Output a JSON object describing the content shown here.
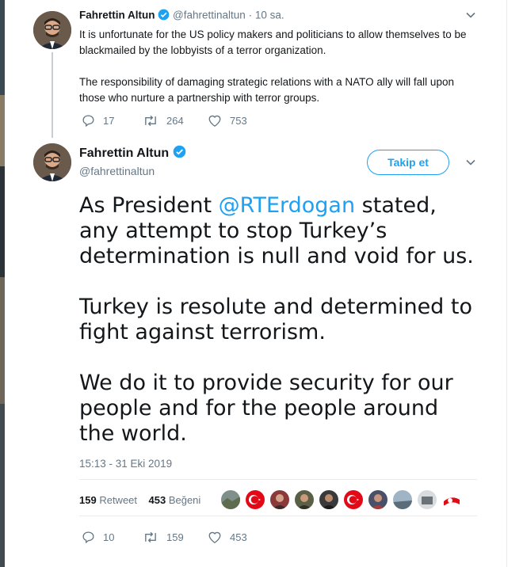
{
  "tweet_reply": {
    "name": "Fahrettin Altun",
    "handle": "@fahrettinaltun",
    "separator": "·",
    "time": "10 sa.",
    "paragraph_1": "It is unfortunate for the US policy makers and politicians to allow themselves to be blackmailed by the lobbyists of a terror organization.",
    "paragraph_2": "The responsibility of damaging strategic relations with a NATO ally will fall upon those who nurture a partnership with terror groups.",
    "replies": "17",
    "retweets": "264",
    "likes": "753"
  },
  "tweet_main": {
    "name": "Fahrettin Altun",
    "handle": "@fahrettinaltun",
    "follow_label": "Takip et",
    "text_1_before": "As President ",
    "text_1_mention": "@RTErdogan",
    "text_1_after": " stated, any attempt to stop Turkey’s determination is null and void for us.",
    "text_2": "Turkey is resolute and determined to fight against terrorism.",
    "text_3": "We do it to provide security for our people and for the people around the world.",
    "timestamp": "15:13 - 31 Eki 2019",
    "retweet_count": "159",
    "retweet_label": "Retweet",
    "like_count": "453",
    "like_label": "Beğeni",
    "replies": "10",
    "retweets": "159",
    "likes": "453"
  },
  "icons": [
    "verified-icon",
    "chevron-down-icon",
    "reply-icon",
    "retweet-icon",
    "like-icon"
  ],
  "colors": {
    "accent": "#1da1f2",
    "muted": "#657786",
    "text": "#14171a"
  }
}
